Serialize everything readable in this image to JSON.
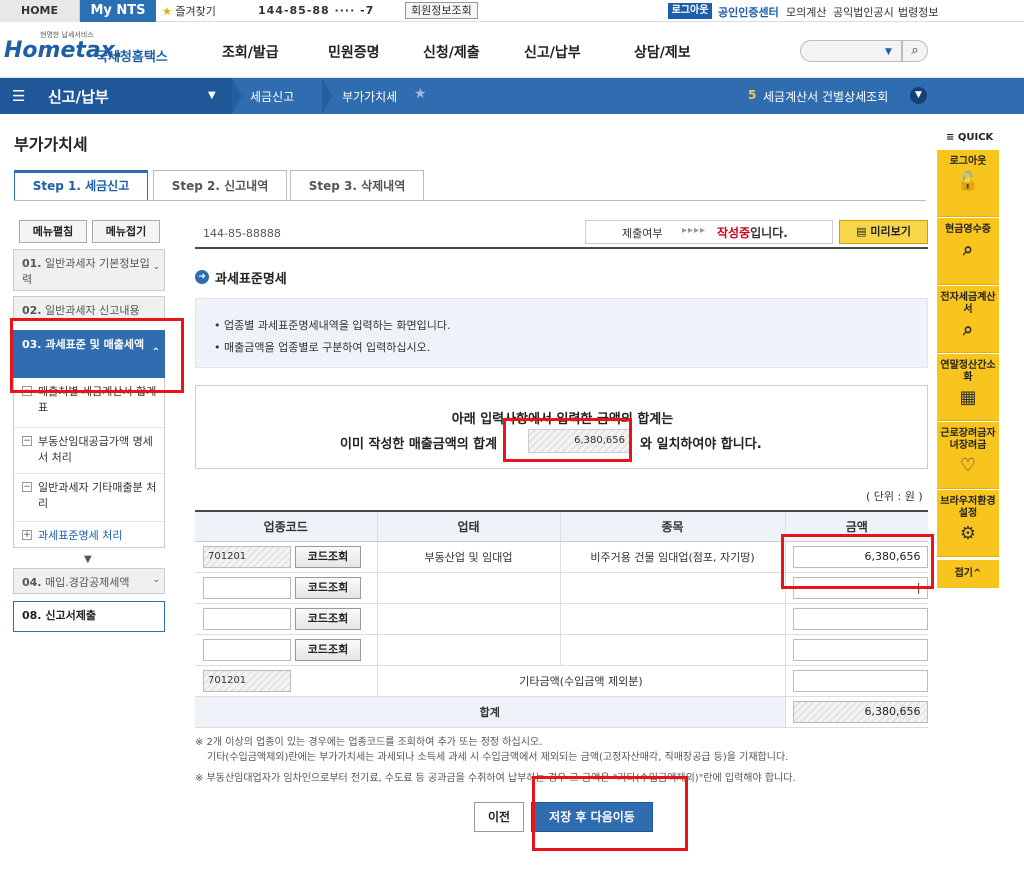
{
  "topbar": {
    "home": "HOME",
    "mynts": "My NTS",
    "favorites": "즐겨찾기",
    "masked_id": "144-85-88 ···· -7",
    "member_btn": "회원정보조회",
    "logout": "로그아웃",
    "cert_center": "공인인증센터",
    "links": [
      "모의계산",
      "공익법인공시",
      "법령정보"
    ]
  },
  "header": {
    "logo_sub": "현명한 납세서비스",
    "logo_main": "Hometax.",
    "logo_ko": "국세청홈택스",
    "gnb": [
      "조회/발급",
      "민원증명",
      "신청/제출",
      "신고/납부",
      "상담/제보"
    ]
  },
  "nav": {
    "title": "신고/납부",
    "crumbs": [
      "세금신고",
      "부가가치세"
    ],
    "notice_num": "5",
    "notice_text": "세금계산서 건별상세조회"
  },
  "page": {
    "title": "부가가치세",
    "tabs": [
      "Step 1. 세금신고",
      "Step 2. 신고내역",
      "Step 3. 삭제내역"
    ]
  },
  "sidebar": {
    "expand": "메뉴펼침",
    "collapse": "메뉴접기",
    "items": [
      {
        "num": "01.",
        "label": "일반과세자 기본정보입력"
      },
      {
        "num": "02.",
        "label": "일반과세자 신고내용"
      },
      {
        "num": "03.",
        "label": "과세표준 및 매출세액"
      },
      {
        "num": "04.",
        "label": "매입.경감공제세액"
      },
      {
        "num": "08.",
        "label": "신고서제출"
      }
    ],
    "subitems": [
      "매출처별 세금계산서 합계표",
      "부동산임대공급가액 명세서 처리",
      "일반과세자 기타매출분 처리",
      "과세표준명세 처리"
    ]
  },
  "main": {
    "masked_id": "144-85-88888",
    "status_label": "제출여부",
    "status_arrows": "▸▸▸▸",
    "status_value_red": "작성중",
    "status_value_suffix": "입니다.",
    "preview": "미리보기",
    "section_title": "과세표준명세",
    "info": [
      "업종별 과세표준명세내역을 입력하는 화면입니다.",
      "매출금액을 업종별로 구분하여 입력하십시오."
    ],
    "sum_line1": "아래 입력사항에서 입력한 금액의 합계는",
    "sum_line2a": "이미 작성한 매출금액의 합계",
    "sum_value": "6,380,656",
    "sum_line2b": "와 일치하여야 합니다.",
    "unit": "( 단위 : 원 )",
    "table": {
      "headers": [
        "업종코드",
        "업태",
        "종목",
        "금액"
      ],
      "code_btn": "코드조회",
      "rows": [
        {
          "code": "701201",
          "type": "부동산업 및 임대업",
          "item": "비주거용 건물 임대업(점포, 자기땅)",
          "amount": "6,380,656"
        },
        {
          "code": "",
          "type": "",
          "item": "",
          "amount": "|"
        },
        {
          "code": "",
          "type": "",
          "item": "",
          "amount": ""
        },
        {
          "code": "",
          "type": "",
          "item": "",
          "amount": ""
        }
      ],
      "other_code": "701201",
      "other_label": "기타금액(수입금액 제외분)",
      "total_label": "합계",
      "total_value": "6,380,656"
    },
    "notes": [
      "※ 2개 이상의 업종이 있는 경우에는 업종코드를 조회하여 추가 또는 정정 하십시오.",
      "기타(수입금액제외)란에는 부가가치세는 과세되나 소득세 과세 시 수입금액에서 제외되는 금액(고정자산매각, 직매장공급 등)을 기재합니다.",
      "※ 부동산임대업자가 임차인으로부터 전기료, 수도료 등 공과금을 수취하여 납부하는 경우 그 금액은 \"기타(수입금액제외)\"란에 입력해야 합니다."
    ],
    "prev": "이전",
    "next": "저장 후 다음이동"
  },
  "quick": {
    "label": "≡ QUICK",
    "items": [
      "로그아웃",
      "현금영수증",
      "전자세금계산서",
      "연말정산간소화",
      "근로장려금자녀장려금",
      "브라우저환경설정"
    ],
    "close": "접기^"
  }
}
